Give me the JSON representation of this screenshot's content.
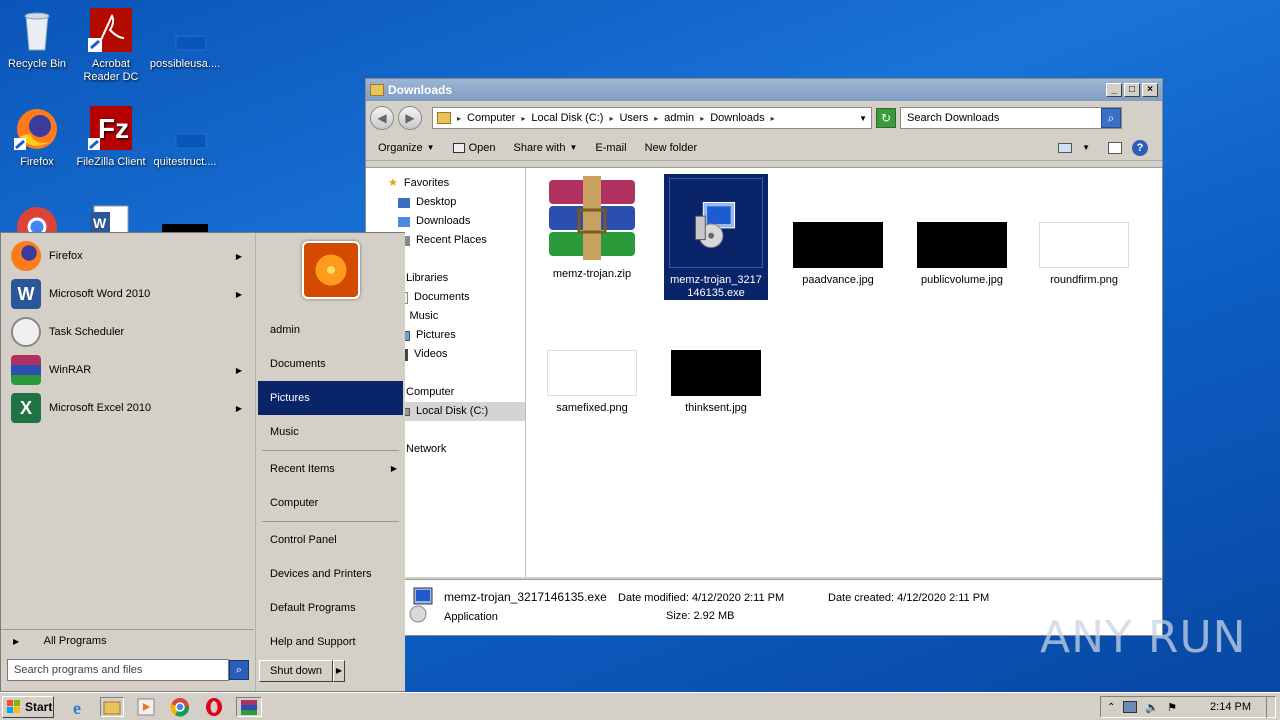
{
  "desktop": {
    "icons": [
      {
        "label": "Recycle Bin"
      },
      {
        "label": "Acrobat Reader DC"
      },
      {
        "label": "possibleusa...."
      },
      {
        "label": "Firefox"
      },
      {
        "label": "FileZilla Client"
      },
      {
        "label": "quitestruct...."
      }
    ]
  },
  "explorer": {
    "title": "Downloads",
    "breadcrumbs": [
      "Computer",
      "Local Disk (C:)",
      "Users",
      "admin",
      "Downloads"
    ],
    "search_placeholder": "Search Downloads",
    "toolbar": {
      "organize": "Organize",
      "open": "Open",
      "share_with": "Share with",
      "email": "E-mail",
      "new_folder": "New folder"
    },
    "nav": {
      "favorites": "Favorites",
      "desktop": "Desktop",
      "downloads": "Downloads",
      "recent_places": "Recent Places",
      "libraries": "Libraries",
      "documents": "Documents",
      "music": "Music",
      "pictures": "Pictures",
      "videos": "Videos",
      "computer": "Computer",
      "local_disk": "Local Disk (C:)",
      "network": "Network"
    },
    "files": [
      {
        "name": "memz-trojan.zip"
      },
      {
        "name": "memz-trojan_3217146135.exe"
      },
      {
        "name": "paadvance.jpg"
      },
      {
        "name": "publicvolume.jpg"
      },
      {
        "name": "roundfirm.png"
      },
      {
        "name": "samefixed.png"
      },
      {
        "name": "thinksent.jpg"
      }
    ],
    "details": {
      "filename": "memz-trojan_3217146135.exe",
      "type": "Application",
      "date_modified": "Date modified: 4/12/2020 2:11 PM",
      "date_created": "Date created: 4/12/2020 2:11 PM",
      "size": "Size: 2.92 MB"
    }
  },
  "startmenu": {
    "programs": [
      {
        "label": "Firefox"
      },
      {
        "label": "Microsoft Word 2010"
      },
      {
        "label": "Task Scheduler"
      },
      {
        "label": "WinRAR"
      },
      {
        "label": "Microsoft Excel 2010"
      }
    ],
    "all_programs": "All Programs",
    "search_placeholder": "Search programs and files",
    "right": {
      "user": "admin",
      "documents": "Documents",
      "pictures": "Pictures",
      "music": "Music",
      "recent_items": "Recent Items",
      "computer": "Computer",
      "control_panel": "Control Panel",
      "devices_printers": "Devices and Printers",
      "default_programs": "Default Programs",
      "help_support": "Help and Support"
    },
    "shutdown": "Shut down"
  },
  "taskbar": {
    "start": "Start",
    "clock": "2:14 PM"
  },
  "watermark": "ANY RUN"
}
